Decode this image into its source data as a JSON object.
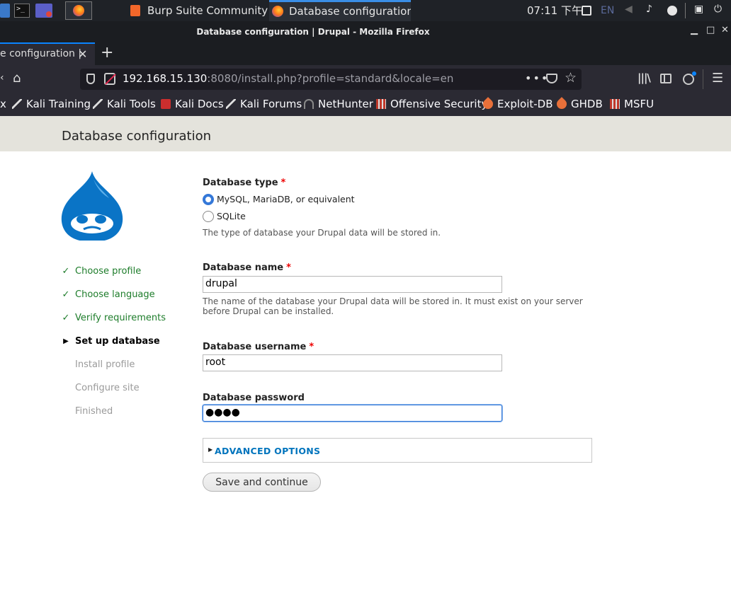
{
  "taskbar": {
    "tasks": [
      {
        "label": "Burp Suite Community E..."
      },
      {
        "label": "Database configuration |..."
      }
    ],
    "clock": "07:11 下午",
    "ime": "EN"
  },
  "window": {
    "title": "Database configuration | Drupal - Mozilla Firefox"
  },
  "tab": {
    "label": "e configuration |"
  },
  "urlbar": {
    "host": "192.168.15.130",
    "rest": ":8080/install.php?profile=standard&locale=en",
    "page_actions": "•••"
  },
  "bookmarks": [
    {
      "label": "Kali Training",
      "icon": "kali-dragon-icon"
    },
    {
      "label": "Kali Tools",
      "icon": "kali-dragon-icon"
    },
    {
      "label": "Kali Docs",
      "icon": "kali-docs-icon"
    },
    {
      "label": "Kali Forums",
      "icon": "kali-dragon-icon"
    },
    {
      "label": "NetHunter",
      "icon": "nethunter-icon"
    },
    {
      "label": "Offensive Security",
      "icon": "offsec-icon"
    },
    {
      "label": "Exploit-DB",
      "icon": "exploit-db-icon"
    },
    {
      "label": "GHDB",
      "icon": "ghdb-icon"
    },
    {
      "label": "MSFU",
      "icon": "msfu-icon"
    }
  ],
  "page": {
    "title": "Database configuration",
    "colors": {
      "header_bg": "#e4e3dc",
      "accent": "#3478d8",
      "link": "#0074bd",
      "done": "#1e7d2b"
    }
  },
  "steps": [
    {
      "label": "Choose profile",
      "state": "done"
    },
    {
      "label": "Choose language",
      "state": "done"
    },
    {
      "label": "Verify requirements",
      "state": "done"
    },
    {
      "label": "Set up database",
      "state": "active"
    },
    {
      "label": "Install profile",
      "state": "pending"
    },
    {
      "label": "Configure site",
      "state": "pending"
    },
    {
      "label": "Finished",
      "state": "pending"
    }
  ],
  "form": {
    "db_type": {
      "label": "Database type",
      "required": "*",
      "options": [
        "MySQL, MariaDB, or equivalent",
        "SQLite"
      ],
      "selected": "MySQL, MariaDB, or equivalent",
      "description": "The type of database your Drupal data will be stored in."
    },
    "db_name": {
      "label": "Database name",
      "required": "*",
      "value": "drupal",
      "description": "The name of the database your Drupal data will be stored in. It must exist on your server before Drupal can be installed."
    },
    "db_username": {
      "label": "Database username",
      "required": "*",
      "value": "root"
    },
    "db_password": {
      "label": "Database password",
      "masked_value": "●●●●"
    },
    "advanced_label": "ADVANCED OPTIONS",
    "submit_label": "Save and continue"
  }
}
